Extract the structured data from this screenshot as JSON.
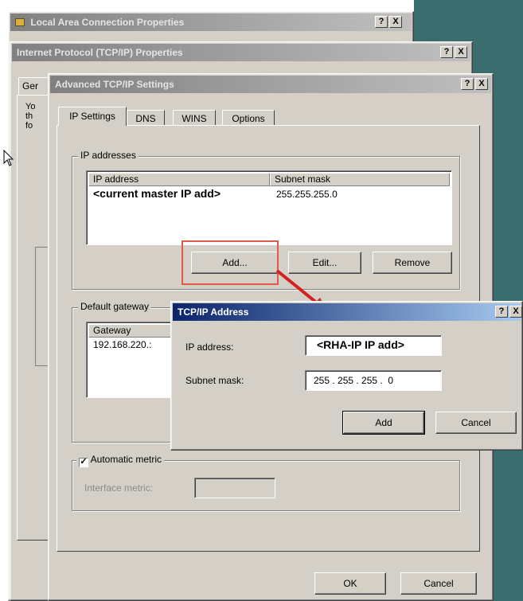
{
  "colors": {
    "desktop": "#3a6e6e",
    "dialog_face": "#d4d0c8",
    "active_title": "#0a246a",
    "highlight_box": "#e05a4a",
    "arrow": "#d42020"
  },
  "window_lan": {
    "title": "Local Area Connection Properties",
    "icon": "network-icon",
    "help": "?",
    "close": "X"
  },
  "window_tcp": {
    "title": "Internet Protocol (TCP/IP) Properties",
    "help": "?",
    "close": "X",
    "tab_label_partial": "Ger",
    "text_partial": [
      "Yo",
      "th",
      "fo"
    ]
  },
  "window_adv": {
    "title": "Advanced TCP/IP Settings",
    "help": "?",
    "close": "X",
    "tabs": [
      "IP Settings",
      "DNS",
      "WINS",
      "Options"
    ],
    "ip_group_label": "IP addresses",
    "ip_columns": [
      "IP address",
      "Subnet mask"
    ],
    "ip_rows": [
      {
        "ip": "<current master IP add>",
        "mask": "255.255.255.0"
      }
    ],
    "add_button": "Add...",
    "edit_button": "Edit...",
    "remove_button": "Remove",
    "gateway_group_label": "Default gateway",
    "gateway_column": "Gateway",
    "gateway_rows": [
      "192.168.220.:"
    ],
    "auto_metric_label": "Automatic metric",
    "auto_metric_checked": true,
    "interface_metric_label": "Interface metric:",
    "ok_button": "OK",
    "cancel_button": "Cancel"
  },
  "dialog_addr": {
    "title": "TCP/IP Address",
    "help": "?",
    "close": "X",
    "ip_label": "IP address:",
    "ip_value": "<RHA-IP IP add>",
    "mask_label": "Subnet mask:",
    "mask_value": "255 . 255 . 255 .  0",
    "add_button": "Add",
    "cancel_button": "Cancel"
  }
}
